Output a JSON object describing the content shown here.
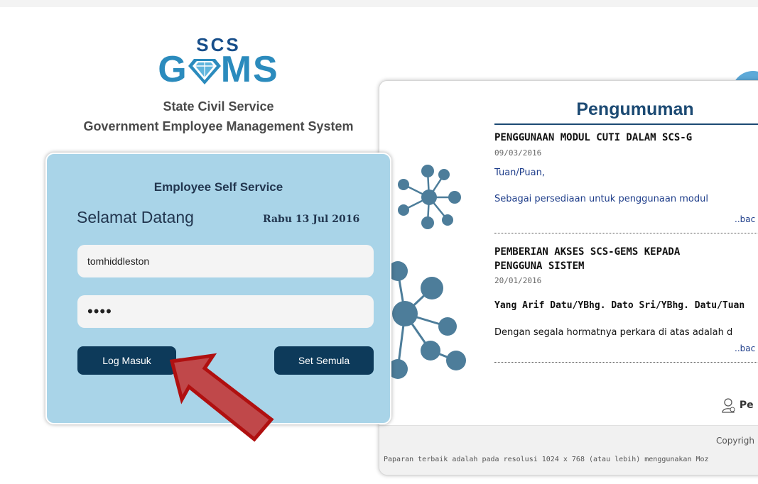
{
  "logo": {
    "top_text": "SCS",
    "main_left": "G",
    "main_right": "MS"
  },
  "header": {
    "line1": "State Civil Service",
    "line2": "Government Employee Management System"
  },
  "login": {
    "panel_title": "Employee Self Service",
    "welcome": "Selamat Datang",
    "date": "Rabu 13 Jul 2016",
    "username_value": "tomhiddleston",
    "password_mask": "••••",
    "login_button": "Log Masuk",
    "reset_button": "Set Semula"
  },
  "announcements": {
    "title": "Pengumuman",
    "items": [
      {
        "title": "PENGGUNAAN MODUL CUTI DALAM SCS-G",
        "date": "09/03/2016",
        "greeting": "Tuan/Puan,",
        "body": "Sebagai persediaan untuk penggunaan modul",
        "more": "..bac"
      },
      {
        "title_line1": "PEMBERIAN AKSES SCS-GEMS KEPADA",
        "title_line2": "PENGGUNA SISTEM",
        "date": "20/01/2016",
        "greeting": "Yang Arif Datu/YBhg. Dato Sri/YBhg. Datu/Tuan",
        "body": "Dengan segala hormatnya perkara di atas adalah d",
        "more": "..bac"
      }
    ],
    "user_link": "Pe",
    "copyright": "Copyrigh",
    "resolution_note": "Paparan terbaik adalah pada resolusi 1024 x 768 (atau lebih) menggunakan Moz"
  },
  "colors": {
    "login_bg": "#a9d4e8",
    "button_bg": "#0d3a5a",
    "title_blue": "#1c4a73",
    "arrow_red": "#c0282a"
  }
}
